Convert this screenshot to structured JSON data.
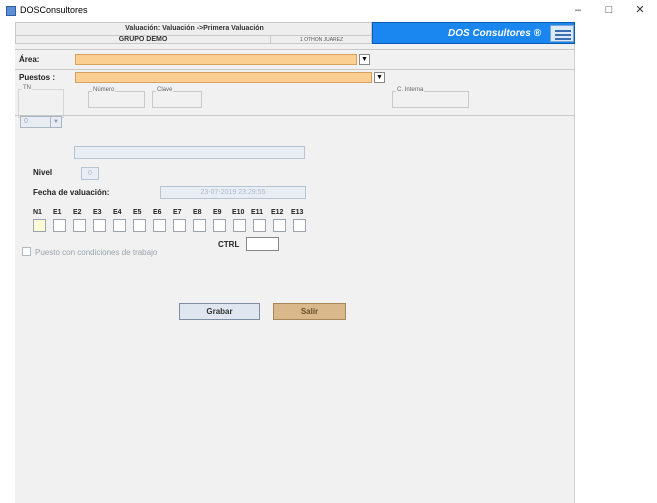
{
  "window": {
    "title": "DOSConsultores",
    "controls": [
      "–",
      "□",
      "✕"
    ]
  },
  "header": {
    "title": "Valuación: Valuación ->Primera Valuación",
    "company": "GRUPO DEMO",
    "user": "1 OTHON JUAREZ",
    "brand": "DOS Consultores ®",
    "brand_icon": "dos-logo-icon"
  },
  "area": {
    "label": "Área:",
    "value": ""
  },
  "puestos": {
    "label": "Puestos :",
    "value": "",
    "tn_legend": "TN",
    "tn_value": "0",
    "numero_legend": "Número",
    "clave_legend": "Clave",
    "interna_legend": "C. Interna"
  },
  "form": {
    "nivel_label": "Nivel",
    "nivel_value": "0",
    "fecha_label": "Fecha de valuación:",
    "fecha_value": "23-07-2019 23:29:55",
    "factor_labels": [
      "N1",
      "E1",
      "E2",
      "E3",
      "E4",
      "E5",
      "E6",
      "E7",
      "E8",
      "E9",
      "E10",
      "E11",
      "E12",
      "E13"
    ],
    "ctrl_label": "CTRL",
    "condiciones_label": "Puesto con condiciones de trabajo"
  },
  "buttons": {
    "grabar": "Grabar",
    "salir": "Salir"
  },
  "colors": {
    "accent": "#1a86ef",
    "select": "#fbcf91",
    "salir": "#d9b98c"
  }
}
